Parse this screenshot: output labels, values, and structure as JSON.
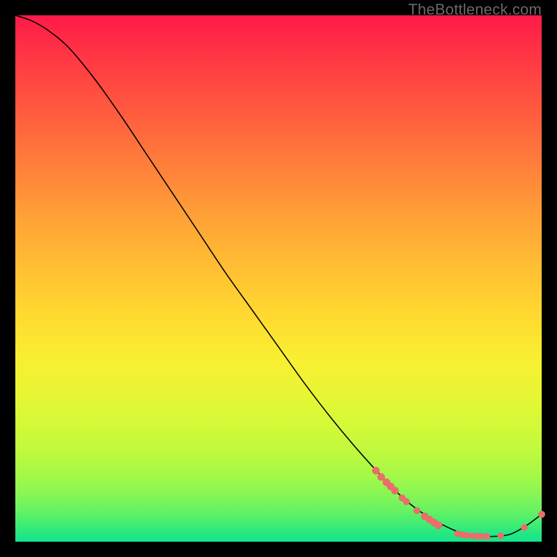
{
  "watermark": "TheBottleneck.com",
  "colors": {
    "dot": "#e86f6a",
    "curve": "#000000"
  },
  "chart_data": {
    "type": "line",
    "title": "",
    "xlabel": "",
    "ylabel": "",
    "xlim": [
      0,
      100
    ],
    "ylim": [
      0,
      100
    ],
    "note": "Axes are implicit (no tick labels visible). x and y are expressed as percentages of the plot box; y=100 at top, y=0 at bottom.",
    "series": [
      {
        "name": "bottleneck-curve",
        "x": [
          0,
          3,
          6,
          10,
          15,
          20,
          25,
          30,
          35,
          40,
          45,
          50,
          55,
          60,
          65,
          70,
          74,
          78,
          82,
          85,
          88,
          91,
          94,
          97,
          100
        ],
        "y": [
          100,
          99,
          97.3,
          94,
          88,
          81,
          73.5,
          66,
          58.5,
          51,
          44,
          37,
          30,
          23.5,
          17.5,
          12,
          8,
          5,
          2.8,
          1.6,
          1.1,
          1,
          1.4,
          3,
          5.2
        ]
      }
    ],
    "highlight_points": {
      "name": "highlighted-samples",
      "description": "Salmon dots lying on/near the curve in the lower-right region",
      "points": [
        {
          "x": 68.5,
          "y": 13.5,
          "r": 5.5
        },
        {
          "x": 69.5,
          "y": 12.3,
          "r": 5.5
        },
        {
          "x": 70.5,
          "y": 11.3,
          "r": 5.5
        },
        {
          "x": 71.3,
          "y": 10.5,
          "r": 5.5
        },
        {
          "x": 72.1,
          "y": 9.7,
          "r": 5.5
        },
        {
          "x": 73.5,
          "y": 8.3,
          "r": 5.0
        },
        {
          "x": 74.3,
          "y": 7.6,
          "r": 5.0
        },
        {
          "x": 76.3,
          "y": 5.9,
          "r": 5.0
        },
        {
          "x": 77.8,
          "y": 4.8,
          "r": 5.5
        },
        {
          "x": 78.7,
          "y": 4.2,
          "r": 5.5
        },
        {
          "x": 79.6,
          "y": 3.6,
          "r": 5.5
        },
        {
          "x": 80.4,
          "y": 3.1,
          "r": 5.5
        },
        {
          "x": 84.0,
          "y": 1.5,
          "r": 4.8
        },
        {
          "x": 85.0,
          "y": 1.3,
          "r": 4.8
        },
        {
          "x": 85.8,
          "y": 1.2,
          "r": 4.8
        },
        {
          "x": 86.9,
          "y": 1.1,
          "r": 4.8
        },
        {
          "x": 87.8,
          "y": 1.05,
          "r": 4.8
        },
        {
          "x": 88.6,
          "y": 1.02,
          "r": 4.8
        },
        {
          "x": 89.6,
          "y": 1.0,
          "r": 4.8
        },
        {
          "x": 92.2,
          "y": 1.1,
          "r": 4.8
        },
        {
          "x": 96.7,
          "y": 2.7,
          "r": 4.8
        },
        {
          "x": 100.0,
          "y": 5.2,
          "r": 5.0
        }
      ]
    }
  }
}
